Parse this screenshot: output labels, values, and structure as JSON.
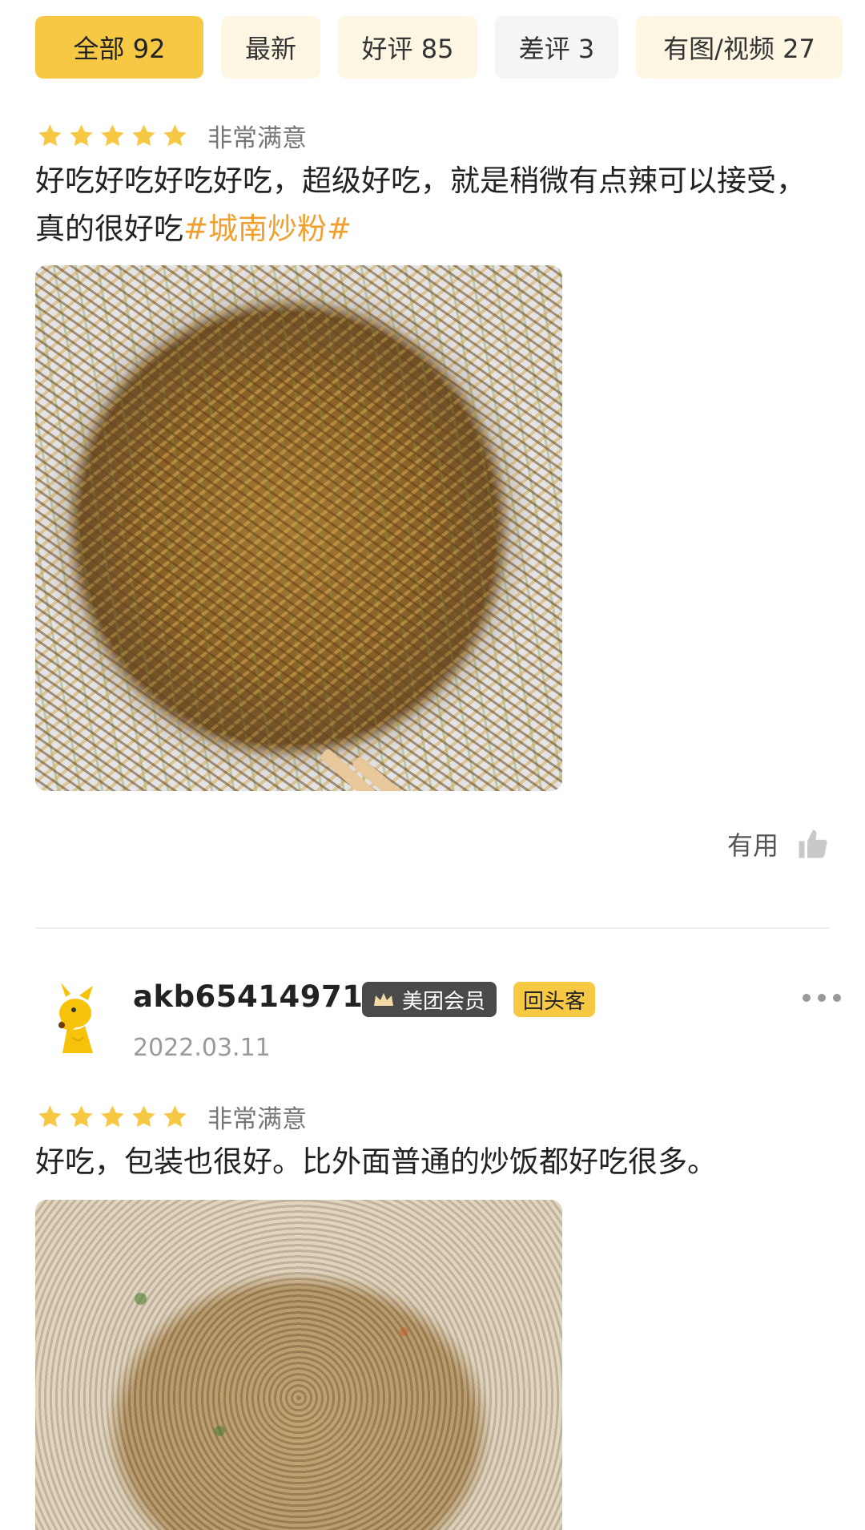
{
  "filter_tabs": [
    {
      "label": "全部 92",
      "active": true
    },
    {
      "label": "最新",
      "active": false
    },
    {
      "label": "好评 85",
      "active": false
    },
    {
      "label": "差评 3",
      "active": false
    },
    {
      "label": "有图/视频 27",
      "active": false
    }
  ],
  "colors": {
    "accent": "#f6c843",
    "tab_bg": "#fdf6e3",
    "star": "#f6c843",
    "tag": "#f0a030"
  },
  "reviews": [
    {
      "rating": 5,
      "rating_label": "非常满意",
      "text": "好吃好吃好吃好吃，超级好吃，就是稍微有点辣可以接受，真的很好吃",
      "tag": "#城南炒粉#",
      "photo_icon": "fried-noodles-photo",
      "useful_label": "有用"
    },
    {
      "username": "akb654149714",
      "member_badge": "美团会员",
      "return_badge": "回头客",
      "date": "2022.03.11",
      "rating": 5,
      "rating_label": "非常满意",
      "text": "好吃，包装也很好。比外面普通的炒饭都好吃很多。",
      "photo_icon": "fried-rice-photo",
      "avatar_icon": "kangaroo-avatar-icon"
    }
  ]
}
